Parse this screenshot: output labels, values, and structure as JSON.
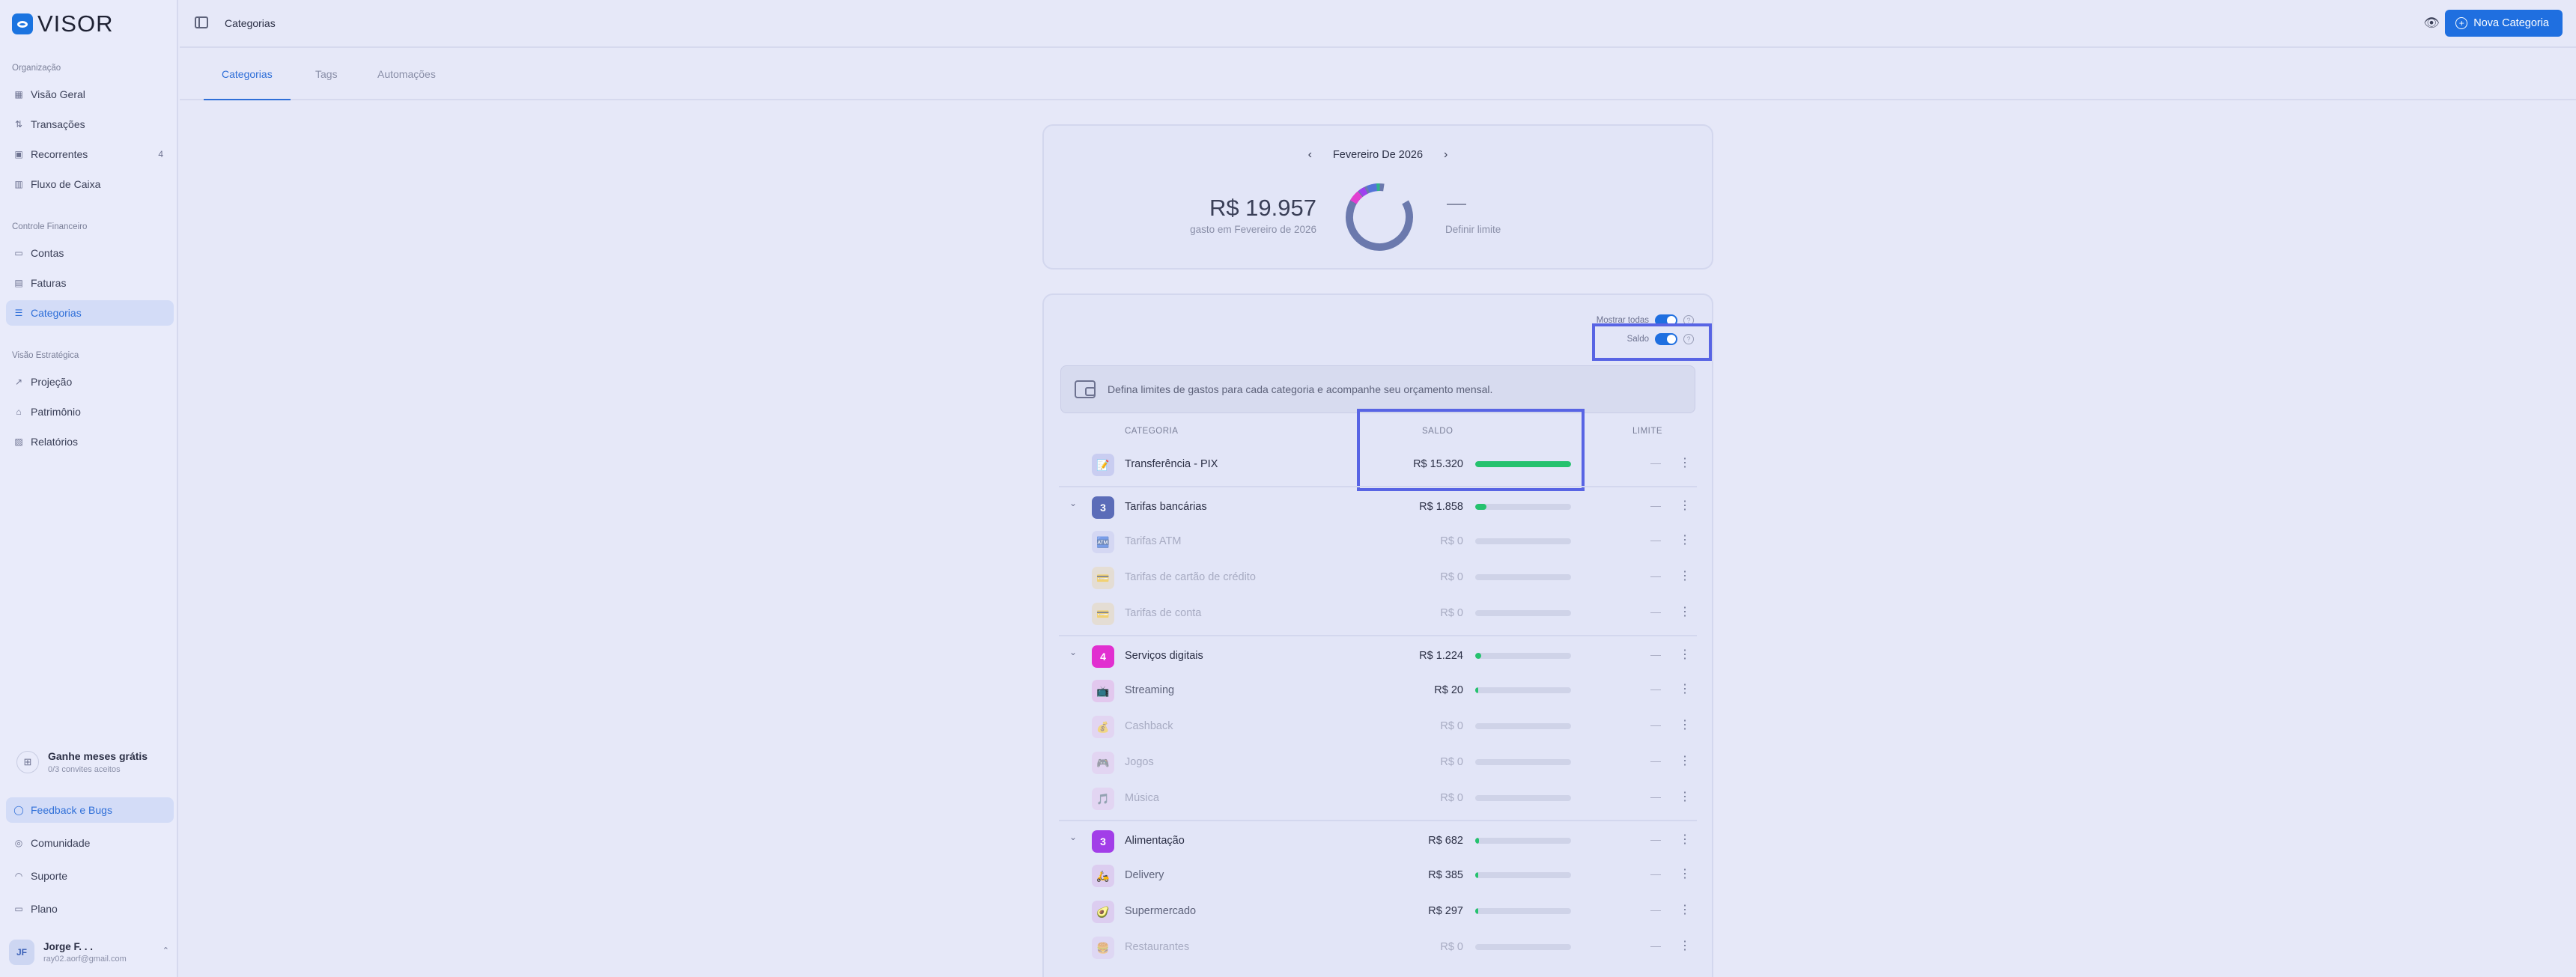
{
  "app": {
    "logo_text": "VISOR"
  },
  "sidebar": {
    "sections": [
      {
        "title": "Organização",
        "items": [
          {
            "label": "Visão Geral",
            "icon": "grid-icon"
          },
          {
            "label": "Transações",
            "icon": "swap-icon"
          },
          {
            "label": "Recorrentes",
            "icon": "calendar-icon",
            "badge": "4"
          },
          {
            "label": "Fluxo de Caixa",
            "icon": "bar-chart-icon"
          }
        ]
      },
      {
        "title": "Controle Financeiro",
        "items": [
          {
            "label": "Contas",
            "icon": "wallet-icon"
          },
          {
            "label": "Faturas",
            "icon": "receipt-icon"
          },
          {
            "label": "Categorias",
            "icon": "tag-list-icon",
            "active": true
          }
        ]
      },
      {
        "title": "Visão Estratégica",
        "items": [
          {
            "label": "Projeção",
            "icon": "trend-icon"
          },
          {
            "label": "Patrimônio",
            "icon": "columns-icon"
          },
          {
            "label": "Relatórios",
            "icon": "chart-icon"
          }
        ]
      }
    ],
    "invite": {
      "title": "Ganhe meses grátis",
      "subtitle": "0/3 convites aceitos"
    },
    "bottom": [
      {
        "label": "Feedback e Bugs",
        "active": true
      },
      {
        "label": "Comunidade"
      },
      {
        "label": "Suporte"
      },
      {
        "label": "Plano"
      }
    ],
    "user": {
      "initials": "JF",
      "name": "Jorge F. . .",
      "email": "ray02.aorf@gmail.com"
    }
  },
  "header": {
    "breadcrumb": "Categorias",
    "new_button": "Nova Categoria"
  },
  "tabs": [
    "Categorias",
    "Tags",
    "Automações"
  ],
  "summary": {
    "month": "Fevereiro De 2026",
    "spent": "R$ 19.957",
    "spent_caption": "gasto em Fevereiro de 2026",
    "limit_link": "Definir limite",
    "donut_colors": [
      "#6b79ad",
      "#e23fd1",
      "#a040ef",
      "#5573d9",
      "#2fb38c"
    ]
  },
  "table": {
    "toggles": {
      "show_all": "Mostrar todas",
      "saldo": "Saldo"
    },
    "info": "Defina limites de gastos para cada categoria e acompanhe seu orçamento mensal.",
    "headers": {
      "category": "CATEGORIA",
      "balance": "SALDO",
      "limit": "LIMITE"
    },
    "rows": [
      {
        "type": "group",
        "name": "Transferência - PIX",
        "amount": "R$ 15.320",
        "progress": 1.0,
        "icon": "memo-icon",
        "icon_glyph": "📝",
        "icon_color": "#c9cdf1",
        "expand": false,
        "limit": "—"
      },
      {
        "type": "group",
        "name": "Tarifas bancárias",
        "amount": "R$ 1.858",
        "progress": 0.12,
        "badge": "3",
        "icon_color": "#5b6cb8",
        "expand": true,
        "limit": "—"
      },
      {
        "type": "sub",
        "name": "Tarifas ATM",
        "amount": "R$ 0",
        "progress": 0,
        "icon": "atm-icon",
        "icon_glyph": "🏧",
        "icon_color": "#c9cdf1",
        "faded": true,
        "limit": "—"
      },
      {
        "type": "sub",
        "name": "Tarifas de cartão de crédito",
        "amount": "R$ 0",
        "progress": 0,
        "icon": "credit-card-icon",
        "icon_glyph": "💳",
        "icon_color": "#e7d8b9",
        "faded": true,
        "limit": "—"
      },
      {
        "type": "sub",
        "name": "Tarifas de conta",
        "amount": "R$ 0",
        "progress": 0,
        "icon": "card-icon",
        "icon_glyph": "💳",
        "icon_color": "#e7d8b9",
        "faded": true,
        "limit": "—"
      },
      {
        "type": "group",
        "name": "Serviços digitais",
        "amount": "R$ 1.224",
        "progress": 0.06,
        "badge": "4",
        "icon_color": "#e12fd0",
        "expand": true,
        "limit": "—"
      },
      {
        "type": "sub",
        "name": "Streaming",
        "amount": "R$ 20",
        "progress": 0.01,
        "icon": "tv-icon",
        "icon_glyph": "📺",
        "icon_color": "#e2c8ee",
        "limit": "—"
      },
      {
        "type": "sub",
        "name": "Cashback",
        "amount": "R$ 0",
        "progress": 0,
        "icon": "money-bag-icon",
        "icon_glyph": "💰",
        "icon_color": "#e2c8ee",
        "faded": true,
        "limit": "—"
      },
      {
        "type": "sub",
        "name": "Jogos",
        "amount": "R$ 0",
        "progress": 0,
        "icon": "gamepad-icon",
        "icon_glyph": "🎮",
        "icon_color": "#e2c8ee",
        "faded": true,
        "limit": "—"
      },
      {
        "type": "sub",
        "name": "Música",
        "amount": "R$ 0",
        "progress": 0,
        "icon": "music-icon",
        "icon_glyph": "🎵",
        "icon_color": "#e2c8ee",
        "faded": true,
        "limit": "—"
      },
      {
        "type": "group",
        "name": "Alimentação",
        "amount": "R$ 682",
        "progress": 0.04,
        "badge": "3",
        "icon_color": "#a23ee8",
        "expand": true,
        "limit": "—"
      },
      {
        "type": "sub",
        "name": "Delivery",
        "amount": "R$ 385",
        "progress": 0.02,
        "icon": "scooter-icon",
        "icon_glyph": "🛵",
        "icon_color": "#dccdf0",
        "limit": "—"
      },
      {
        "type": "sub",
        "name": "Supermercado",
        "amount": "R$ 297",
        "progress": 0.02,
        "icon": "avocado-icon",
        "icon_glyph": "🥑",
        "icon_color": "#dccdf0",
        "limit": "—"
      },
      {
        "type": "sub",
        "name": "Restaurantes",
        "amount": "R$ 0",
        "progress": 0,
        "icon": "burger-icon",
        "icon_glyph": "🍔",
        "icon_color": "#dccdf0",
        "faded": true,
        "limit": "—"
      }
    ]
  }
}
